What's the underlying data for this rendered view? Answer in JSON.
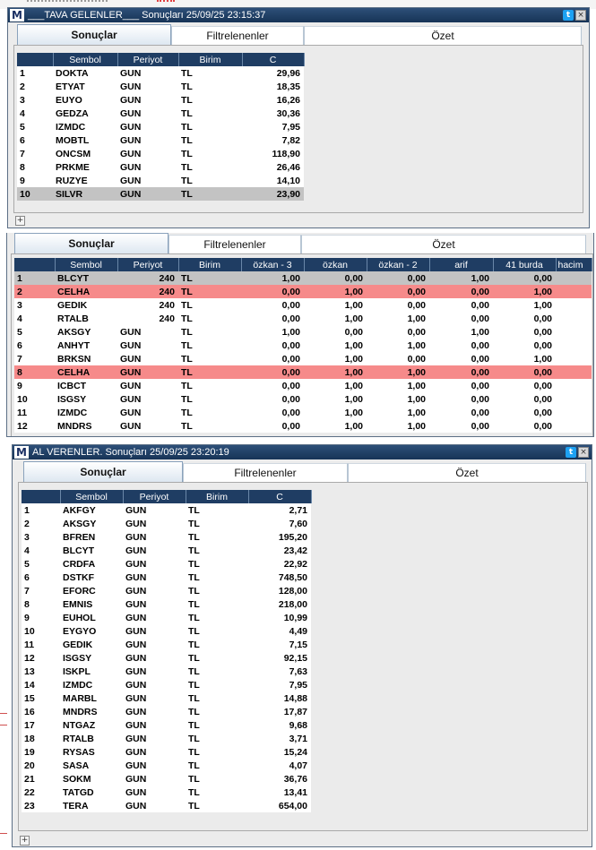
{
  "windows": [
    {
      "title": "___TAVA GELENLER___ Sonuçları  25/09/25 23:15:37",
      "logo": "M",
      "tabs": [
        "Sonuçlar",
        "Filtrelenenler",
        "Özet"
      ],
      "columns": [
        "Sembol",
        "Periyot",
        "Birim",
        "C"
      ],
      "rows": [
        [
          "1",
          "DOKTA",
          "GUN",
          "TL",
          "29,96"
        ],
        [
          "2",
          "ETYAT",
          "GUN",
          "TL",
          "18,35"
        ],
        [
          "3",
          "EUYO",
          "GUN",
          "TL",
          "16,26"
        ],
        [
          "4",
          "GEDZA",
          "GUN",
          "TL",
          "30,36"
        ],
        [
          "5",
          "IZMDC",
          "GUN",
          "TL",
          "7,95"
        ],
        [
          "6",
          "MOBTL",
          "GUN",
          "TL",
          "7,82"
        ],
        [
          "7",
          "ONCSM",
          "GUN",
          "TL",
          "118,90"
        ],
        [
          "8",
          "PRKME",
          "GUN",
          "TL",
          "26,46"
        ],
        [
          "9",
          "RUZYE",
          "GUN",
          "TL",
          "14,10"
        ],
        [
          "10",
          "SILVR",
          "GUN",
          "TL",
          "23,90"
        ]
      ],
      "selected_row": 10,
      "plus": "+"
    },
    {
      "tabs": [
        "Sonuçlar",
        "Filtrelenenler",
        "Özet"
      ],
      "columns": [
        "Sembol",
        "Periyot",
        "Birim",
        "özkan - 3",
        "özkan",
        "özkan - 2",
        "arif",
        "41 burda",
        "hacim"
      ],
      "rows": [
        [
          "1",
          "BLCYT",
          "240",
          "TL",
          "1,00",
          "0,00",
          "0,00",
          "1,00",
          "0,00"
        ],
        [
          "2",
          "CELHA",
          "240",
          "TL",
          "0,00",
          "1,00",
          "0,00",
          "0,00",
          "1,00"
        ],
        [
          "3",
          "GEDIK",
          "240",
          "TL",
          "0,00",
          "1,00",
          "0,00",
          "0,00",
          "1,00"
        ],
        [
          "4",
          "RTALB",
          "240",
          "TL",
          "0,00",
          "1,00",
          "1,00",
          "0,00",
          "0,00"
        ],
        [
          "5",
          "AKSGY",
          "GUN",
          "TL",
          "1,00",
          "0,00",
          "0,00",
          "1,00",
          "0,00"
        ],
        [
          "6",
          "ANHYT",
          "GUN",
          "TL",
          "0,00",
          "1,00",
          "1,00",
          "0,00",
          "0,00"
        ],
        [
          "7",
          "BRKSN",
          "GUN",
          "TL",
          "0,00",
          "1,00",
          "0,00",
          "0,00",
          "1,00"
        ],
        [
          "8",
          "CELHA",
          "GUN",
          "TL",
          "0,00",
          "1,00",
          "1,00",
          "0,00",
          "0,00"
        ],
        [
          "9",
          "ICBCT",
          "GUN",
          "TL",
          "0,00",
          "1,00",
          "1,00",
          "0,00",
          "0,00"
        ],
        [
          "10",
          "ISGSY",
          "GUN",
          "TL",
          "0,00",
          "1,00",
          "1,00",
          "0,00",
          "0,00"
        ],
        [
          "11",
          "IZMDC",
          "GUN",
          "TL",
          "0,00",
          "1,00",
          "1,00",
          "0,00",
          "0,00"
        ],
        [
          "12",
          "MNDRS",
          "GUN",
          "TL",
          "0,00",
          "1,00",
          "1,00",
          "0,00",
          "0,00"
        ]
      ],
      "selected_row": 1,
      "highlight_rows": [
        2,
        8
      ],
      "highlight_color": "#f68a8a"
    },
    {
      "title": "AL VERENLER. Sonuçları  25/09/25 23:20:19",
      "logo": "M",
      "tabs": [
        "Sonuçlar",
        "Filtrelenenler",
        "Özet"
      ],
      "columns": [
        "Sembol",
        "Periyot",
        "Birim",
        "C"
      ],
      "rows": [
        [
          "1",
          "AKFGY",
          "GUN",
          "TL",
          "2,71"
        ],
        [
          "2",
          "AKSGY",
          "GUN",
          "TL",
          "7,60"
        ],
        [
          "3",
          "BFREN",
          "GUN",
          "TL",
          "195,20"
        ],
        [
          "4",
          "BLCYT",
          "GUN",
          "TL",
          "23,42"
        ],
        [
          "5",
          "CRDFA",
          "GUN",
          "TL",
          "22,92"
        ],
        [
          "6",
          "DSTKF",
          "GUN",
          "TL",
          "748,50"
        ],
        [
          "7",
          "EFORC",
          "GUN",
          "TL",
          "128,00"
        ],
        [
          "8",
          "EMNIS",
          "GUN",
          "TL",
          "218,00"
        ],
        [
          "9",
          "EUHOL",
          "GUN",
          "TL",
          "10,99"
        ],
        [
          "10",
          "EYGYO",
          "GUN",
          "TL",
          "4,49"
        ],
        [
          "11",
          "GEDIK",
          "GUN",
          "TL",
          "7,15"
        ],
        [
          "12",
          "ISGSY",
          "GUN",
          "TL",
          "92,15"
        ],
        [
          "13",
          "ISKPL",
          "GUN",
          "TL",
          "7,63"
        ],
        [
          "14",
          "IZMDC",
          "GUN",
          "TL",
          "7,95"
        ],
        [
          "15",
          "MARBL",
          "GUN",
          "TL",
          "14,88"
        ],
        [
          "16",
          "MNDRS",
          "GUN",
          "TL",
          "17,87"
        ],
        [
          "17",
          "NTGAZ",
          "GUN",
          "TL",
          "9,68"
        ],
        [
          "18",
          "RTALB",
          "GUN",
          "TL",
          "3,71"
        ],
        [
          "19",
          "RYSAS",
          "GUN",
          "TL",
          "15,24"
        ],
        [
          "20",
          "SASA",
          "GUN",
          "TL",
          "4,07"
        ],
        [
          "21",
          "SOKM",
          "GUN",
          "TL",
          "36,76"
        ],
        [
          "22",
          "TATGD",
          "GUN",
          "TL",
          "13,41"
        ],
        [
          "23",
          "TERA",
          "GUN",
          "TL",
          "654,00"
        ]
      ],
      "plus": "+"
    }
  ],
  "colors": {
    "titlebar": "#1f3d63",
    "header": "#1f3d63",
    "selected": "#c3c3c3",
    "highlight": "#f68a8a"
  }
}
